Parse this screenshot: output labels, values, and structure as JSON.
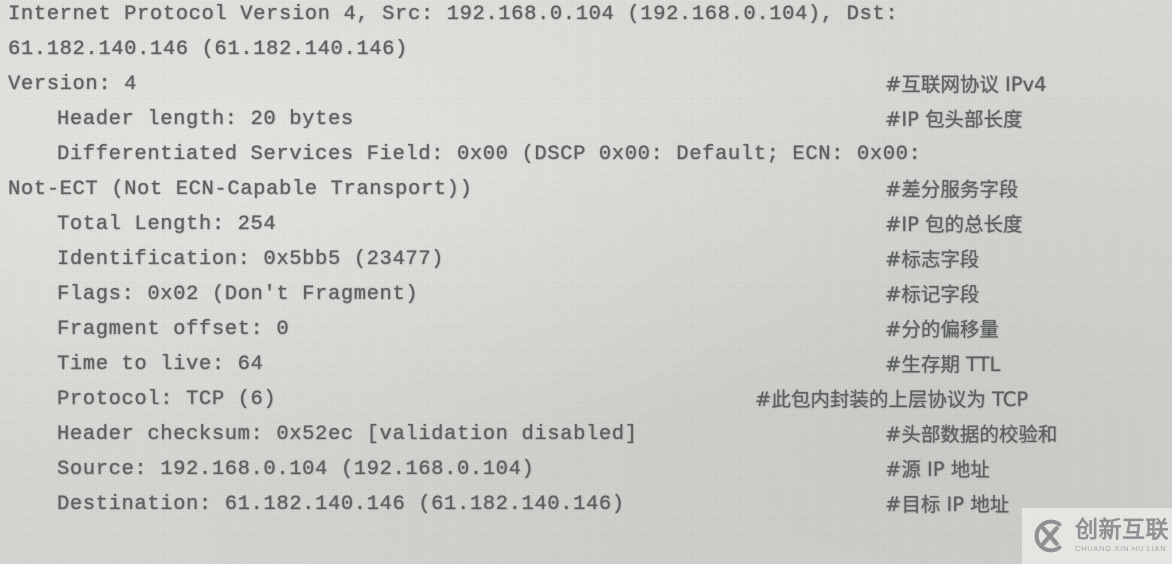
{
  "document": {
    "type": "scanned-book-page",
    "language": "mixed-en-zh",
    "background_color": "#d9d9d5",
    "text_color": "#55585a"
  },
  "packet_detail": {
    "title": "Internet Protocol Version 4, Src: 192.168.0.104 (192.168.0.104), Dst: 61.182.140.146 (61.182.140.146)",
    "lines": [
      {
        "id": "ipv4-header-line-1",
        "text": "Internet Protocol Version 4, Src: 192.168.0.104 (192.168.0.104), Dst:",
        "indent": "none",
        "annotation": ""
      },
      {
        "id": "ipv4-header-line-2",
        "text": "61.182.140.146 (61.182.140.146)",
        "indent": "none",
        "annotation": ""
      },
      {
        "id": "field-version",
        "text": "Version: 4",
        "indent": "none",
        "annotation": "#互联网协议 IPv4"
      },
      {
        "id": "field-header-length",
        "text": "Header length: 20 bytes",
        "indent": "field",
        "annotation": "#IP 包头部长度"
      },
      {
        "id": "field-differentiated-services-line-1",
        "text": "Differentiated Services Field: 0x00 (DSCP 0x00: Default; ECN: 0x00:",
        "indent": "field",
        "annotation": ""
      },
      {
        "id": "field-differentiated-services-line-2",
        "text": "Not-ECT (Not ECN-Capable Transport))",
        "indent": "none",
        "annotation": "#差分服务字段"
      },
      {
        "id": "field-total-length",
        "text": "Total Length: 254",
        "indent": "field",
        "annotation": "#IP 包的总长度"
      },
      {
        "id": "field-identification",
        "text": "Identification: 0x5bb5 (23477)",
        "indent": "field",
        "annotation": "#标志字段"
      },
      {
        "id": "field-flags",
        "text": "Flags: 0x02 (Don't Fragment)",
        "indent": "field",
        "annotation": "#标记字段"
      },
      {
        "id": "field-fragment-offset",
        "text": "Fragment offset: 0",
        "indent": "field",
        "annotation": "#分的偏移量"
      },
      {
        "id": "field-time-to-live",
        "text": "Time to live: 64",
        "indent": "field",
        "annotation": "#生存期 TTL"
      },
      {
        "id": "field-protocol",
        "text": "Protocol: TCP (6)",
        "indent": "field",
        "annotation": "#此包内封装的上层协议为 TCP"
      },
      {
        "id": "field-header-checksum",
        "text": "Header checksum: 0x52ec [validation disabled]",
        "indent": "field",
        "annotation": "#头部数据的校验和"
      },
      {
        "id": "field-source",
        "text": "Source: 192.168.0.104 (192.168.0.104)",
        "indent": "field",
        "annotation": "#源 IP 地址"
      },
      {
        "id": "field-destination",
        "text": "Destination: 61.182.140.146 (61.182.140.146)",
        "indent": "field",
        "annotation": "#目标 IP 地址"
      }
    ]
  },
  "annotations": {
    "version": "#互联网协议 IPv4",
    "header_length": "#IP 包头部长度",
    "differentiated_services": "#差分服务字段",
    "total_length": "#IP 包的总长度",
    "identification": "#标志字段",
    "flags": "#标记字段",
    "fragment_offset": "#分的偏移量",
    "time_to_live": "#生存期 TTL",
    "protocol": "#此包内封装的上层协议为 TCP",
    "header_checksum": "#头部数据的校验和",
    "source": "#源 IP 地址",
    "destination": "#目标 IP 地址"
  },
  "watermark": {
    "cn_name": "创新互联",
    "en_name": "CHUANG XIN HU LIAN",
    "logo_icon": "cx-circle-logo",
    "color": "#8e9093"
  }
}
